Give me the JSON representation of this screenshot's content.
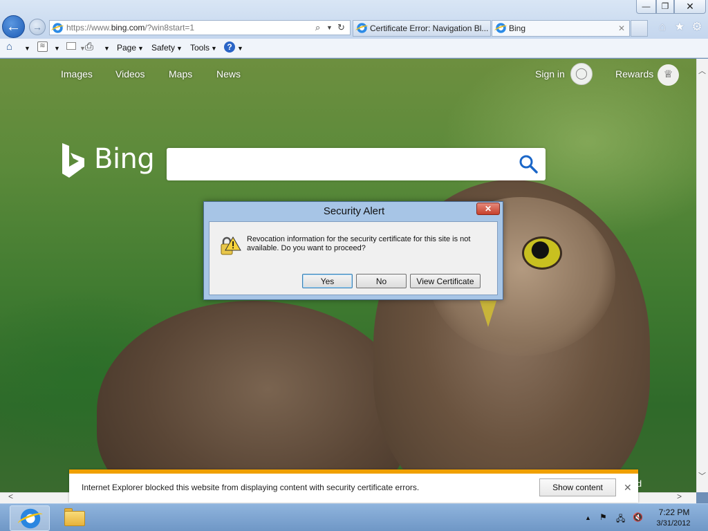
{
  "window": {
    "minimize_label": "—",
    "maximize_label": "❐",
    "close_label": "✕"
  },
  "address_bar": {
    "url_prefix": "https://www.",
    "url_host": "bing.com",
    "url_suffix": "/?win8start=1"
  },
  "tabs": [
    {
      "label": "Certificate Error: Navigation Bl...",
      "icon": "ie-icon"
    },
    {
      "label": "Bing",
      "icon": "ie-icon",
      "close_label": "✕"
    }
  ],
  "command_bar": {
    "page_label": "Page",
    "safety_label": "Safety",
    "tools_label": "Tools",
    "help_label": "?"
  },
  "bing": {
    "nav": [
      "Images",
      "Videos",
      "Maps",
      "News"
    ],
    "sign_in_label": "Sign in",
    "rewards_label": "Rewards",
    "logo_text": "Bing",
    "partial_text": "ld"
  },
  "dialog": {
    "title": "Security Alert",
    "close_label": "✕",
    "message": "Revocation information for the security certificate for this site is not available. Do you want to proceed?",
    "yes_label": "Yes",
    "no_label": "No",
    "view_certificate_label": "View Certificate"
  },
  "notification": {
    "message": "Internet Explorer blocked this website from displaying content with security certificate errors.",
    "show_content_label": "Show content",
    "close_label": "✕"
  },
  "taskbar": {
    "time": "7:22 PM",
    "date": "3/31/2012"
  },
  "colors": {
    "accent_blue": "#2a64c6",
    "notification_accent": "#f0a000",
    "dialog_frame": "#a7c5e6"
  }
}
